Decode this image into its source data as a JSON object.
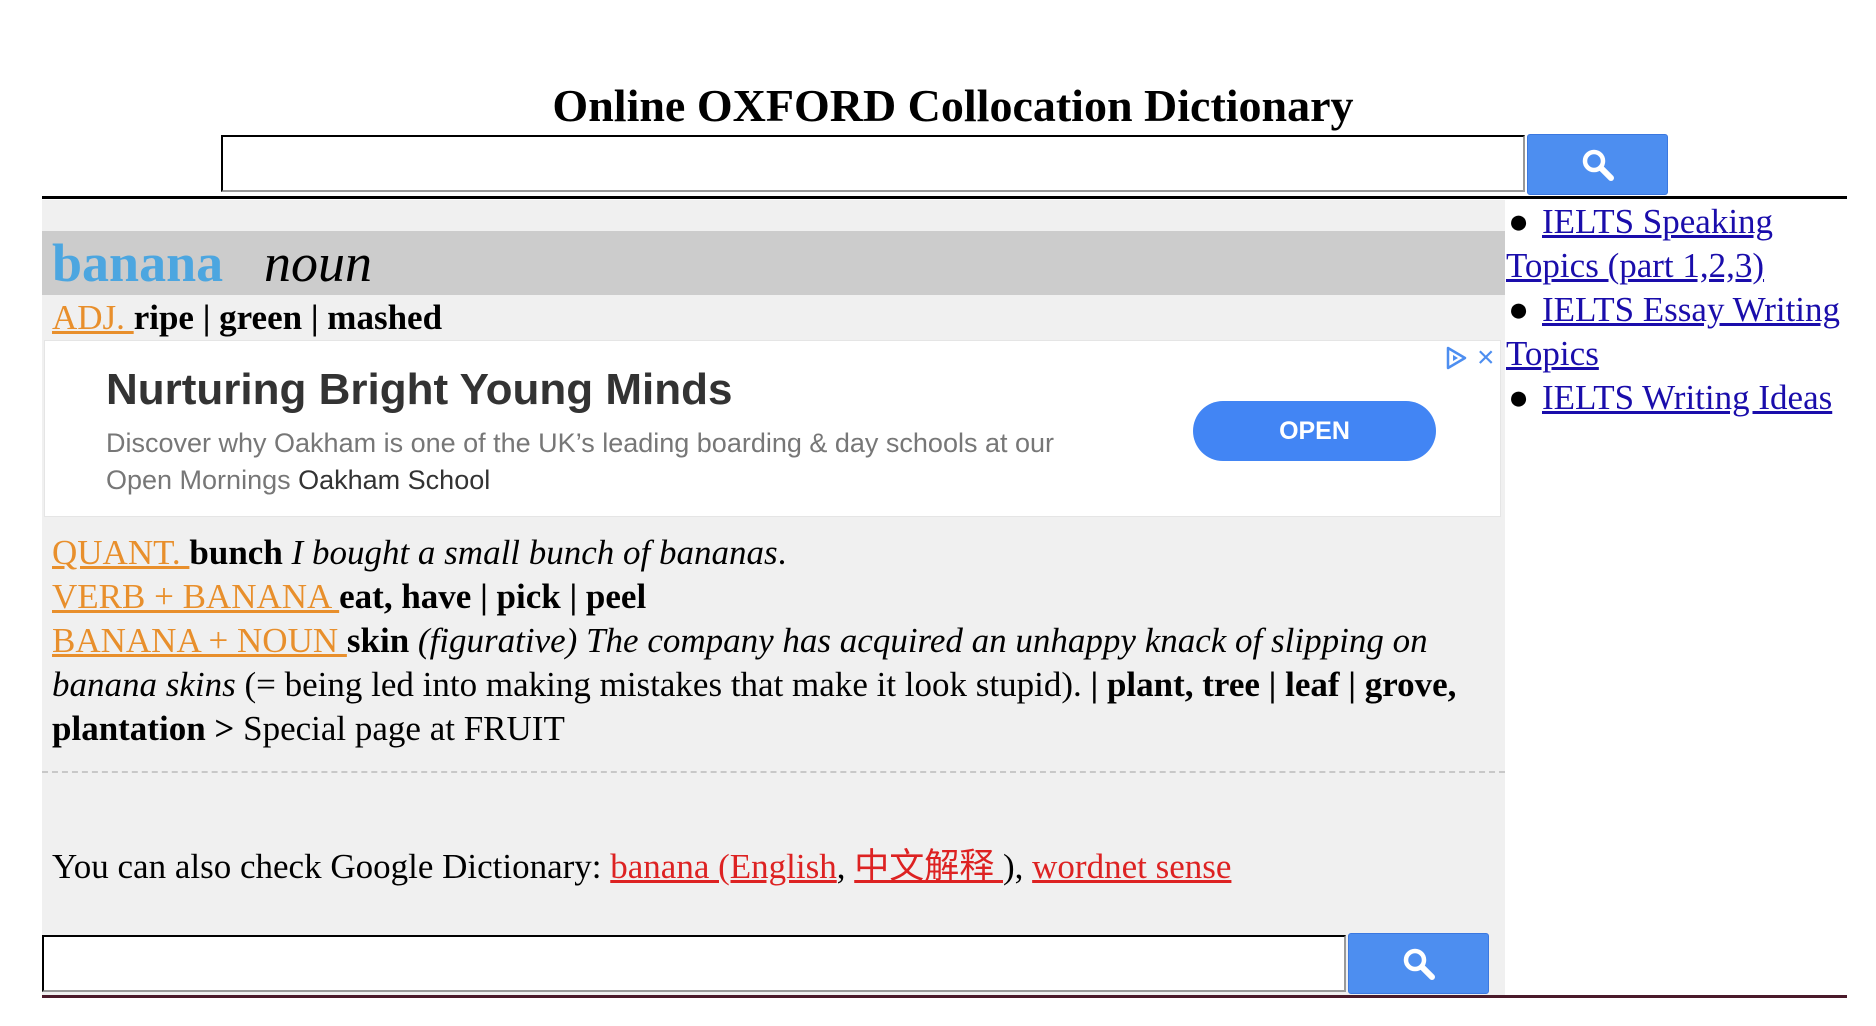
{
  "site": {
    "title": "Online OXFORD Collocation Dictionary"
  },
  "search": {
    "top_value": "",
    "bottom_value": "",
    "button_icon": "search-icon"
  },
  "entry": {
    "headword": "banana",
    "pos": "noun",
    "adj": {
      "label": "ADJ. ",
      "words": "ripe | green | mashed"
    },
    "quant": {
      "label": "QUANT. ",
      "words": "bunch",
      "example": "I bought a small bunch of bananas",
      "period": "."
    },
    "verb": {
      "label": "VERB + BANANA ",
      "words": "eat, have | pick | peel"
    },
    "noun": {
      "label": "BANANA + NOUN ",
      "word1": "skin",
      "fig": "(figurative)",
      "example1": "The company has acquired an unhappy knack of slipping on",
      "example2": "banana skins",
      "explain": "(= being led into making mistakes that make it look stupid).",
      "rest": "| plant, tree | leaf | grove,",
      "last": "plantation",
      "special_prefix": " > ",
      "special": "Special page at FRUIT"
    }
  },
  "ad": {
    "title": "Nurturing Bright Young Minds",
    "desc": "Discover why Oakham is one of the UK’s leading boarding & day schools at our Open Mornings",
    "advertiser": "Oakham School",
    "button": "OPEN",
    "choices_icon": "ad-choices-icon",
    "close_label": "×",
    "button_color": "#4285f4"
  },
  "google": {
    "prefix": "You can also check Google Dictionary: ",
    "link1": "banana (English",
    "sep": ", ",
    "link2": "中文解释 ",
    "close": "), ",
    "link3": "wordnet sense"
  },
  "sidebar": {
    "items": [
      {
        "label": "IELTS Speaking Topics (part 1,2,3)"
      },
      {
        "label": "IELTS Essay Writing Topics"
      },
      {
        "label": "IELTS Writing Ideas"
      }
    ]
  },
  "colors": {
    "headword": "#4ca6e0",
    "label_orange": "#e88f2c",
    "link_red": "#dd2222",
    "sidebar_link": "#1a0dab",
    "search_button": "#4d8ef0"
  }
}
